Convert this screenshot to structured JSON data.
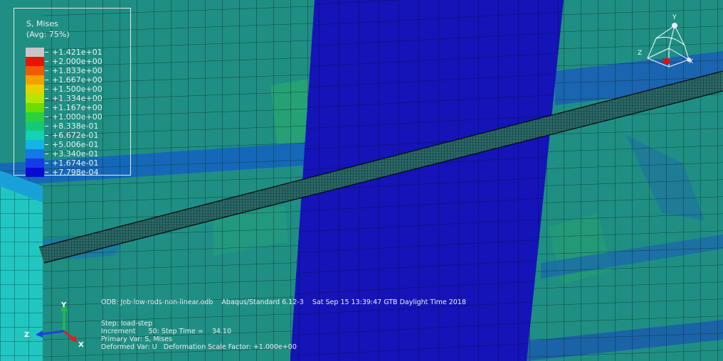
{
  "legend": {
    "title": "S, Mises",
    "subtitle": "(Avg: 75%)",
    "entries": [
      {
        "value": "+1.421e+01",
        "color": "#c8c8c8"
      },
      {
        "value": "+2.000e+00",
        "color": "#e61400"
      },
      {
        "value": "+1.833e+00",
        "color": "#f05a00"
      },
      {
        "value": "+1.667e+00",
        "color": "#f5a000"
      },
      {
        "value": "+1.500e+00",
        "color": "#e6d200"
      },
      {
        "value": "+1.334e+00",
        "color": "#b4e600"
      },
      {
        "value": "+1.167e+00",
        "color": "#6edc00"
      },
      {
        "value": "+1.000e+00",
        "color": "#28d23c"
      },
      {
        "value": "+8.338e-01",
        "color": "#14c878"
      },
      {
        "value": "+6.672e-01",
        "color": "#14d2b4"
      },
      {
        "value": "+5.006e-01",
        "color": "#14b4e6"
      },
      {
        "value": "+3.340e-01",
        "color": "#1478e6"
      },
      {
        "value": "+1.674e-01",
        "color": "#143ce6"
      },
      {
        "value": "+7.798e-04",
        "color": "#0a0ad2"
      }
    ]
  },
  "info": {
    "odb_line": "ODB: Job-low-rods-non-linear.odb    Abaqus/Standard 6.12-3    Sat Sep 15 13:39:47 GTB Daylight Time 2018",
    "step_line": "Step: load-step",
    "increment_line": "Increment      50: Step Time =    34.10",
    "primary_line": "Primary Var: S, Mises",
    "deformed_line": "Deformed Var: U   Deformation Scale Factor: +1.000e+00"
  },
  "triad": {
    "x": "X",
    "y": "Y",
    "z": "Z"
  },
  "view_triad": {
    "x": "X",
    "y": "Y",
    "z": "Z"
  }
}
